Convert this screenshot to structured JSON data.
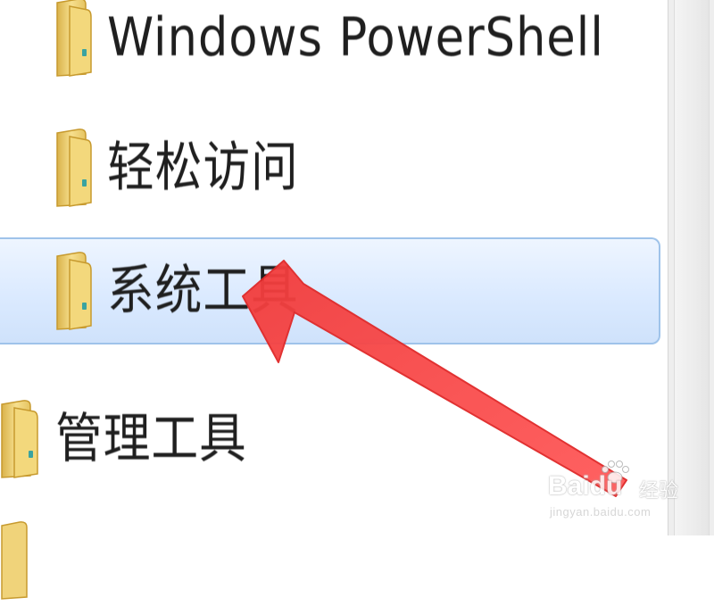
{
  "start_menu": {
    "items": [
      {
        "label": "Windows PowerShell",
        "icon": "folder-icon",
        "selected": false
      },
      {
        "label": "轻松访问",
        "icon": "folder-icon",
        "selected": false
      },
      {
        "label": "系统工具",
        "icon": "folder-icon",
        "selected": true
      },
      {
        "label": "管理工具",
        "icon": "folder-icon",
        "selected": false
      },
      {
        "label": "",
        "icon": "folder-icon",
        "selected": false
      }
    ]
  },
  "annotation": {
    "arrow_color": "#f04040",
    "points_to": "系统工具"
  },
  "watermark": {
    "brand": "Baidu",
    "name": "经验",
    "url": "jingyan.baidu.com"
  },
  "colors": {
    "selection_fill": "#dbeaff",
    "selection_border": "#9fc3ea",
    "folder": "#f0d37a",
    "text": "#1f1f1f"
  }
}
